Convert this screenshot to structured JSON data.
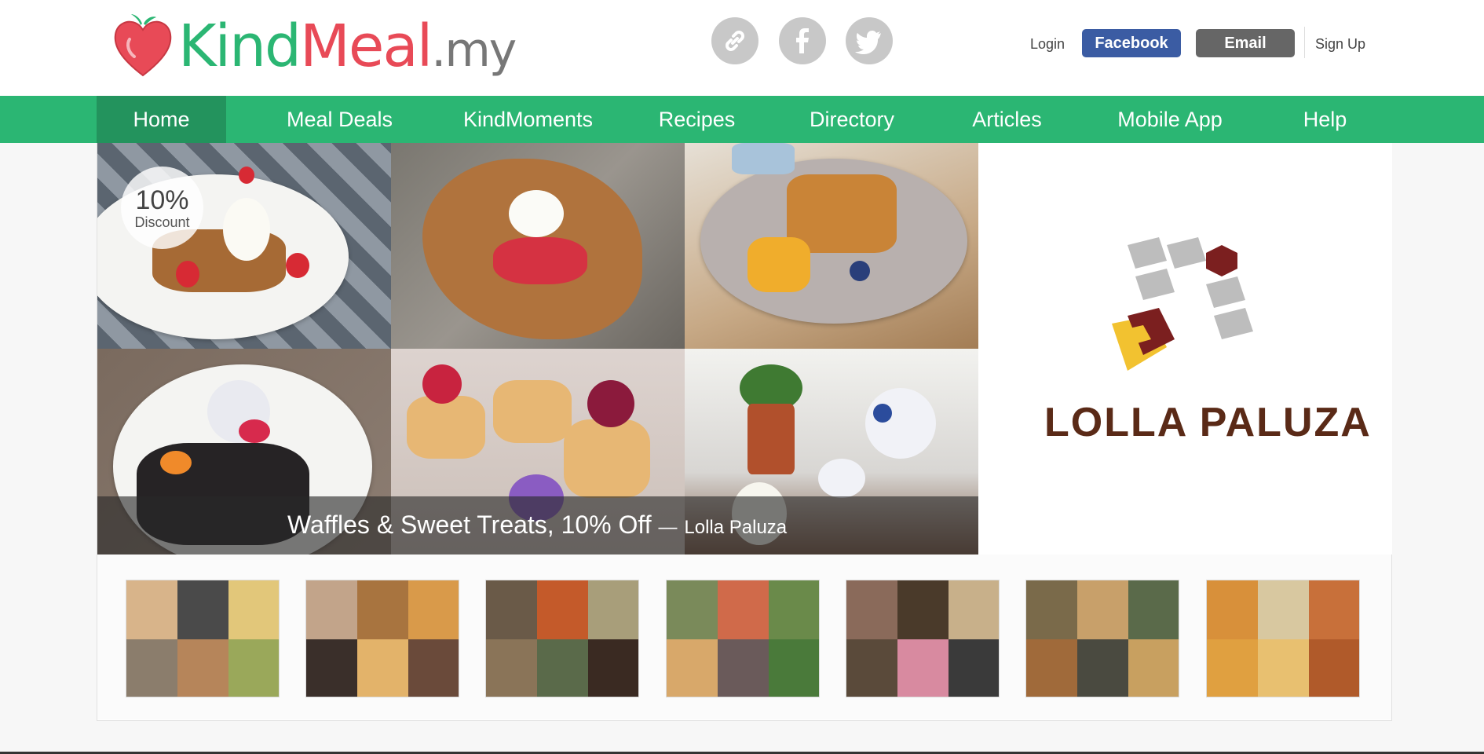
{
  "logo": {
    "part1": "Kind",
    "part2": "Meal",
    "part3": ".my"
  },
  "social": [
    {
      "icon": "link-icon",
      "label": "Share link"
    },
    {
      "icon": "facebook-icon",
      "label": "Facebook share"
    },
    {
      "icon": "twitter-icon",
      "label": "Twitter share"
    }
  ],
  "auth": {
    "login": "Login",
    "facebook": "Facebook",
    "email": "Email",
    "signup": "Sign Up"
  },
  "nav": {
    "items": [
      "Home",
      "Meal Deals",
      "KindMoments",
      "Recipes",
      "Directory",
      "Articles",
      "Mobile App",
      "Help"
    ],
    "active": "Home"
  },
  "deal": {
    "discount_value": "10%",
    "discount_label": "Discount",
    "title": "Waffles & Sweet Treats, 10% Off",
    "separator": "—",
    "merchant": "Lolla Paluza",
    "brand_logo_text": "LOLLA PALUZA"
  },
  "colors": {
    "brand_green": "#2bb673",
    "nav_active": "#23935d",
    "brand_red": "#e84a57",
    "facebook_blue": "#3b5ca3",
    "email_gray": "#666666"
  }
}
